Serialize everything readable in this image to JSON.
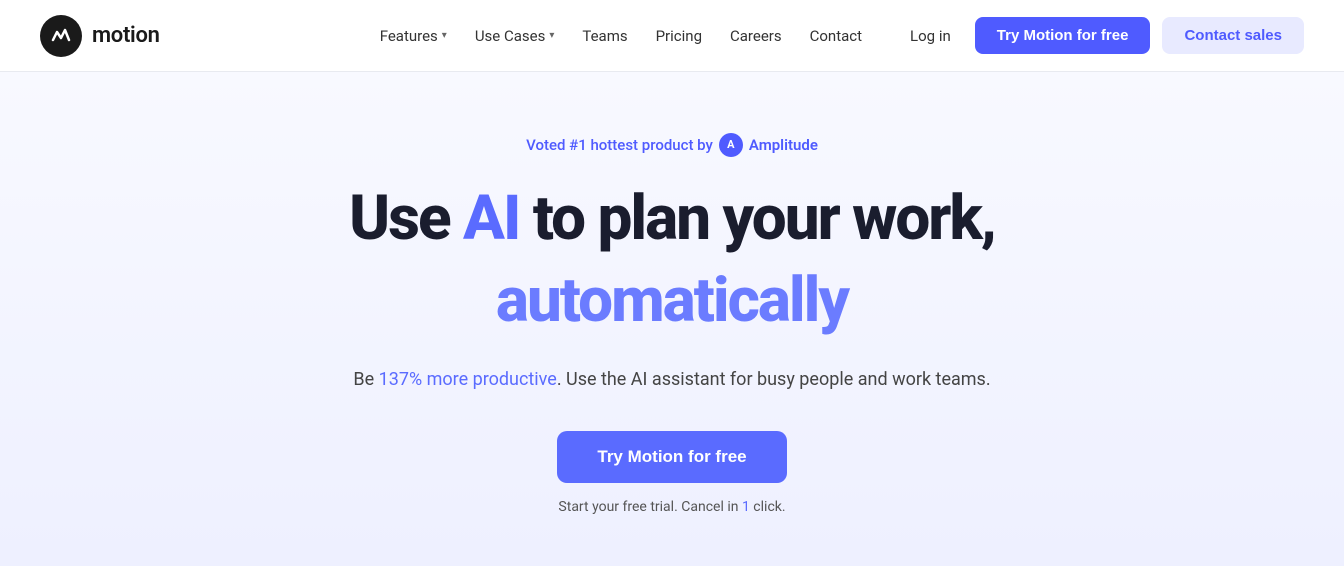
{
  "brand": {
    "logo_text": "motion",
    "logo_alt": "Motion logo"
  },
  "nav": {
    "links": [
      {
        "label": "Features",
        "has_dropdown": true
      },
      {
        "label": "Use Cases",
        "has_dropdown": true
      },
      {
        "label": "Teams",
        "has_dropdown": false
      },
      {
        "label": "Pricing",
        "has_dropdown": false
      },
      {
        "label": "Careers",
        "has_dropdown": false
      },
      {
        "label": "Contact",
        "has_dropdown": false
      }
    ],
    "login_label": "Log in",
    "try_free_label": "Try Motion for free",
    "contact_sales_label": "Contact sales"
  },
  "hero": {
    "badge_text": "Voted #1 hottest product by",
    "badge_brand": "Amplitude",
    "title_part1": "Use ",
    "title_ai": "AI",
    "title_part2": " to plan your work,",
    "title_line2": "automatically",
    "description_part1": "Be ",
    "description_productive": "137% more productive",
    "description_part2": ". Use the AI assistant for busy people and work teams.",
    "cta_button": "Try Motion for free",
    "subtext_part1": "Start your ",
    "subtext_free": "free trial",
    "subtext_part2": ". Cancel in ",
    "subtext_click": "1",
    "subtext_part3": " click."
  }
}
